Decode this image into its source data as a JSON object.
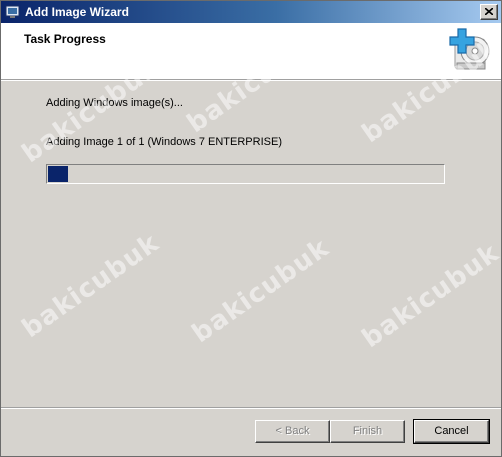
{
  "window": {
    "title": "Add Image Wizard",
    "close_icon": "close-icon"
  },
  "header": {
    "title": "Task Progress",
    "icon": "add-image-icon"
  },
  "main": {
    "status_text": "Adding Windows image(s)...",
    "progress_text": "Adding Image 1 of 1 (Windows 7 ENTERPRISE)",
    "progress_fraction": 0.05
  },
  "buttons": {
    "back_label": "< Back",
    "finish_label": "Finish",
    "cancel_label": "Cancel"
  },
  "watermark": "bakicubuk",
  "colors": {
    "accent": "#0a246a",
    "background": "#d6d3ce"
  }
}
